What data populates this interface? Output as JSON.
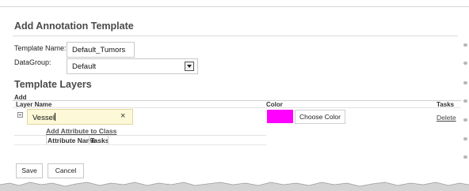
{
  "dialog": {
    "title": "Add Annotation Template"
  },
  "form": {
    "template_name_label": "Template Name:",
    "template_name_value": "Default_Tumors",
    "datagroup_label": "DataGroup:",
    "datagroup_value": "Default"
  },
  "layers": {
    "section_title": "Template Layers",
    "add_label": "Add",
    "columns": {
      "layer_name": "Layer Name",
      "color": "Color",
      "tasks": "Tasks"
    },
    "rows": [
      {
        "name": "Vessel",
        "clear_glyph": "×",
        "color": "#ff00ff",
        "choose_color_label": "Choose Color",
        "delete_label": "Delete",
        "add_attribute_label": "Add Attribute to Class",
        "attribute_columns": {
          "name": "Attribute Name",
          "tasks": "Tasks"
        }
      }
    ]
  },
  "buttons": {
    "save": "Save",
    "cancel": "Cancel"
  },
  "icons": {
    "expand": "collapse-toggle-icon",
    "dropdown": "chevron-down-icon",
    "clear": "close-icon"
  }
}
